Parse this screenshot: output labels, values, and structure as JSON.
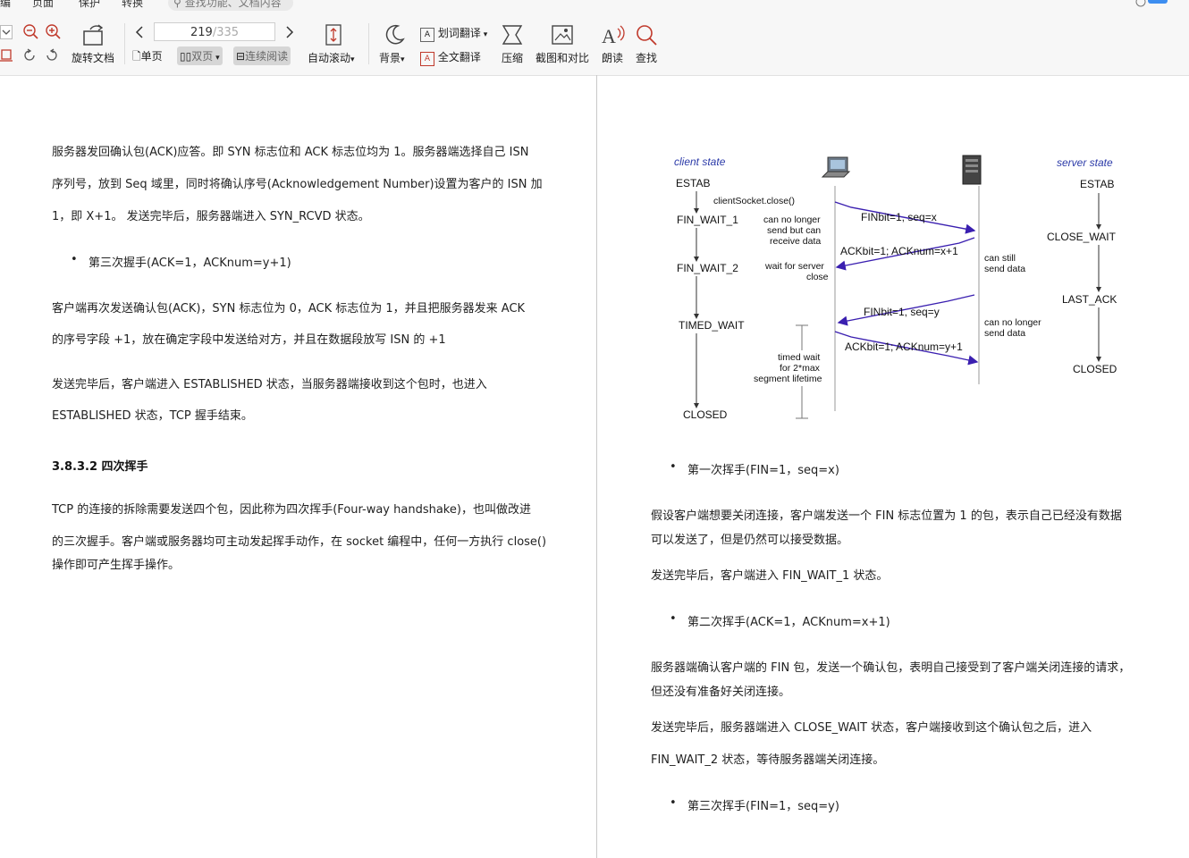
{
  "toolbar": {
    "tabs": [
      "编",
      "页面",
      "保护",
      "转换"
    ],
    "search_placeholder": "查找功能、文档内容",
    "rotate_label": "旋转文档",
    "page_current": "219",
    "page_total": "/335",
    "single_label": "单页",
    "double_label": "双页",
    "continuous_label": "连续阅读",
    "autoscroll_label": "自动滚动",
    "background_label": "背景",
    "word_translate_label": "划词翻译",
    "full_translate_label": "全文翻译",
    "compress_label": "压缩",
    "screenshot_compare_label": "截图和对比",
    "read_aloud_label": "朗读",
    "find_label": "查找"
  },
  "left_page": {
    "p1_lines": [
      "服务器发回确认包(ACK)应答。即  SYN  标志位和  ACK  标志位均为  1。服务器端选择自己  ISN",
      "序列号，放到  Seq  域里，同时将确认序号(Acknowledgement Number)设置为客户的  ISN  加",
      "1，即  X+1。  发送完毕后，服务器端进入 SYN_RCVD 状态。"
    ],
    "bullet3": "第三次握手(ACK=1，ACKnum=y+1)",
    "p2_lines": [
      "客户端再次发送确认包(ACK)，SYN  标志位为  0，ACK  标志位为  1，并且把服务器发来  ACK",
      "的序号字段  +1，放在确定字段中发送给对方，并且在数据段放写  ISN  的  +1"
    ],
    "p3_lines": [
      "发送完毕后，客户端进入  ESTABLISHED  状态，当服务器端接收到这个包时，也进入",
      "ESTABLISHED  状态，TCP  握手结束。"
    ],
    "heading": "3.8.3.2  四次挥手",
    "p4_lines": [
      "TCP  的连接的拆除需要发送四个包，因此称为四次挥手(Four-way handshake)，也叫做改进",
      "的三次握手。客户端或服务器均可主动发起挥手动作，在  socket  编程中，任何一方执行  close()",
      "操作即可产生挥手操作。"
    ]
  },
  "diagram": {
    "client_state": "client state",
    "server_state": "server state",
    "client_states": [
      "ESTAB",
      "FIN_WAIT_1",
      "FIN_WAIT_2",
      "TIMED_WAIT",
      "CLOSED"
    ],
    "server_states": [
      "ESTAB",
      "CLOSE_WAIT",
      "LAST_ACK",
      "CLOSED"
    ],
    "close_call": "clientSocket.close()",
    "msg1": "FINbit=1, seq=x",
    "msg2": "ACKbit=1; ACKnum=x+1",
    "msg3": "FINbit=1, seq=y",
    "msg4": "ACKbit=1; ACKnum=y+1",
    "note_no_longer_send": [
      "can no longer",
      "send but can",
      "receive data"
    ],
    "note_wait_server": [
      "wait for server",
      "close"
    ],
    "note_can_still": [
      "can still",
      "send data"
    ],
    "note_no_longer_send_data": [
      "can no longer",
      "send data"
    ],
    "note_timed_wait": [
      "timed wait",
      "for 2*max",
      "segment lifetime"
    ]
  },
  "right_page": {
    "bullet1": "第一次挥手(FIN=1，seq=x)",
    "p1_lines": [
      "假设客户端想要关闭连接，客户端发送一个  FIN  标志位置为 1 的包，表示自己已经没有数据",
      "可以发送了，但是仍然可以接受数据。"
    ],
    "p2": "发送完毕后，客户端进入  FIN_WAIT_1  状态。",
    "bullet2": "第二次挥手(ACK=1，ACKnum=x+1)",
    "p3_lines": [
      "服务器端确认客户端的  FIN  包，发送一个确认包，表明自己接受到了客户端关闭连接的请求，",
      "但还没有准备好关闭连接。"
    ],
    "p4_lines": [
      "发送完毕后，服务器端进入  CLOSE_WAIT  状态，客户端接收到这个确认包之后，进入",
      "FIN_WAIT_2  状态，等待服务器端关闭连接。"
    ],
    "bullet3": "第三次挥手(FIN=1，seq=y)"
  },
  "colors": {
    "arrow": "#3a1fb0",
    "state_label": "#2b3aa8"
  }
}
